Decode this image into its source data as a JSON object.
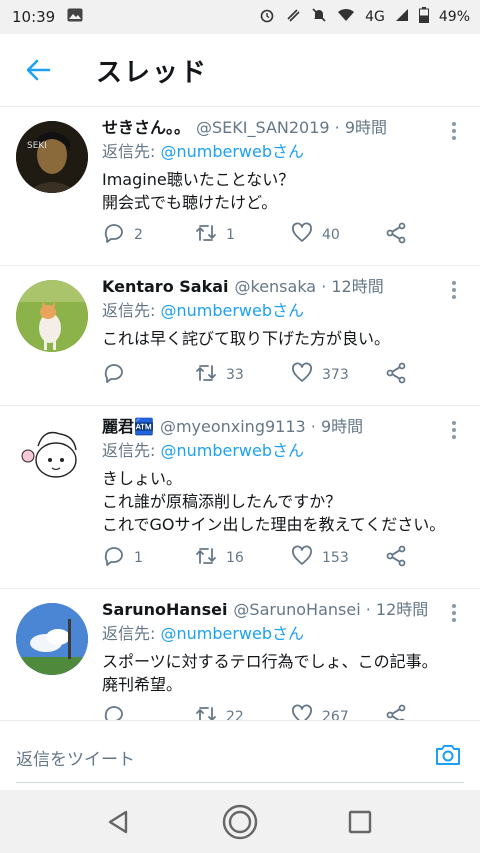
{
  "status_bar": {
    "time": "10:39",
    "network": "4G",
    "battery": "49%",
    "icons": [
      "image-icon",
      "alarm-icon",
      "nfc-icon",
      "mute-icon",
      "wifi-icon",
      "signal-icon",
      "battery-icon"
    ]
  },
  "header": {
    "title": "スレッド"
  },
  "tweets": [
    {
      "name": "せきさん。。",
      "handle": "@SEKI_SAN2019 · 9時間",
      "reply_label": "返信先: ",
      "reply_to": "@numberwebさん",
      "text": "Imagine聴いたことない？\n開会式でも聴けたけど。",
      "replies": "2",
      "retweets": "1",
      "likes": "40",
      "avatar_bg": "#2c2418"
    },
    {
      "name": "Kentaro Sakai",
      "handle": "@kensaka · 12時間",
      "reply_label": "返信先: ",
      "reply_to": "@numberwebさん",
      "text": "これは早く詫びて取り下げた方が良い。",
      "replies": "",
      "retweets": "33",
      "likes": "373",
      "avatar_bg": "#7a9e3e"
    },
    {
      "name": "麗君🏧",
      "handle": "@myeonxing9113 · 9時間",
      "reply_label": "返信先: ",
      "reply_to": "@numberwebさん",
      "text": "きしょい。\nこれ誰が原稿添削したんですか？\nこれでGOサイン出した理由を教えてください。",
      "replies": "1",
      "retweets": "16",
      "likes": "153",
      "avatar_bg": "#ffffff"
    },
    {
      "name": "SarunoHansei",
      "handle": "@SarunoHansei · 12時間",
      "reply_label": "返信先: ",
      "reply_to": "@numberwebさん",
      "text": "スポーツに対するテロ行為でしょ、この記事。\n廃刊希望。",
      "replies": "",
      "retweets": "22",
      "likes": "267",
      "avatar_bg": "#4a86d4"
    }
  ],
  "composer": {
    "placeholder": "返信をツイート"
  },
  "colors": {
    "accent": "#1da1f2",
    "secondary_text": "#657786",
    "divider": "#e6ecf0"
  }
}
